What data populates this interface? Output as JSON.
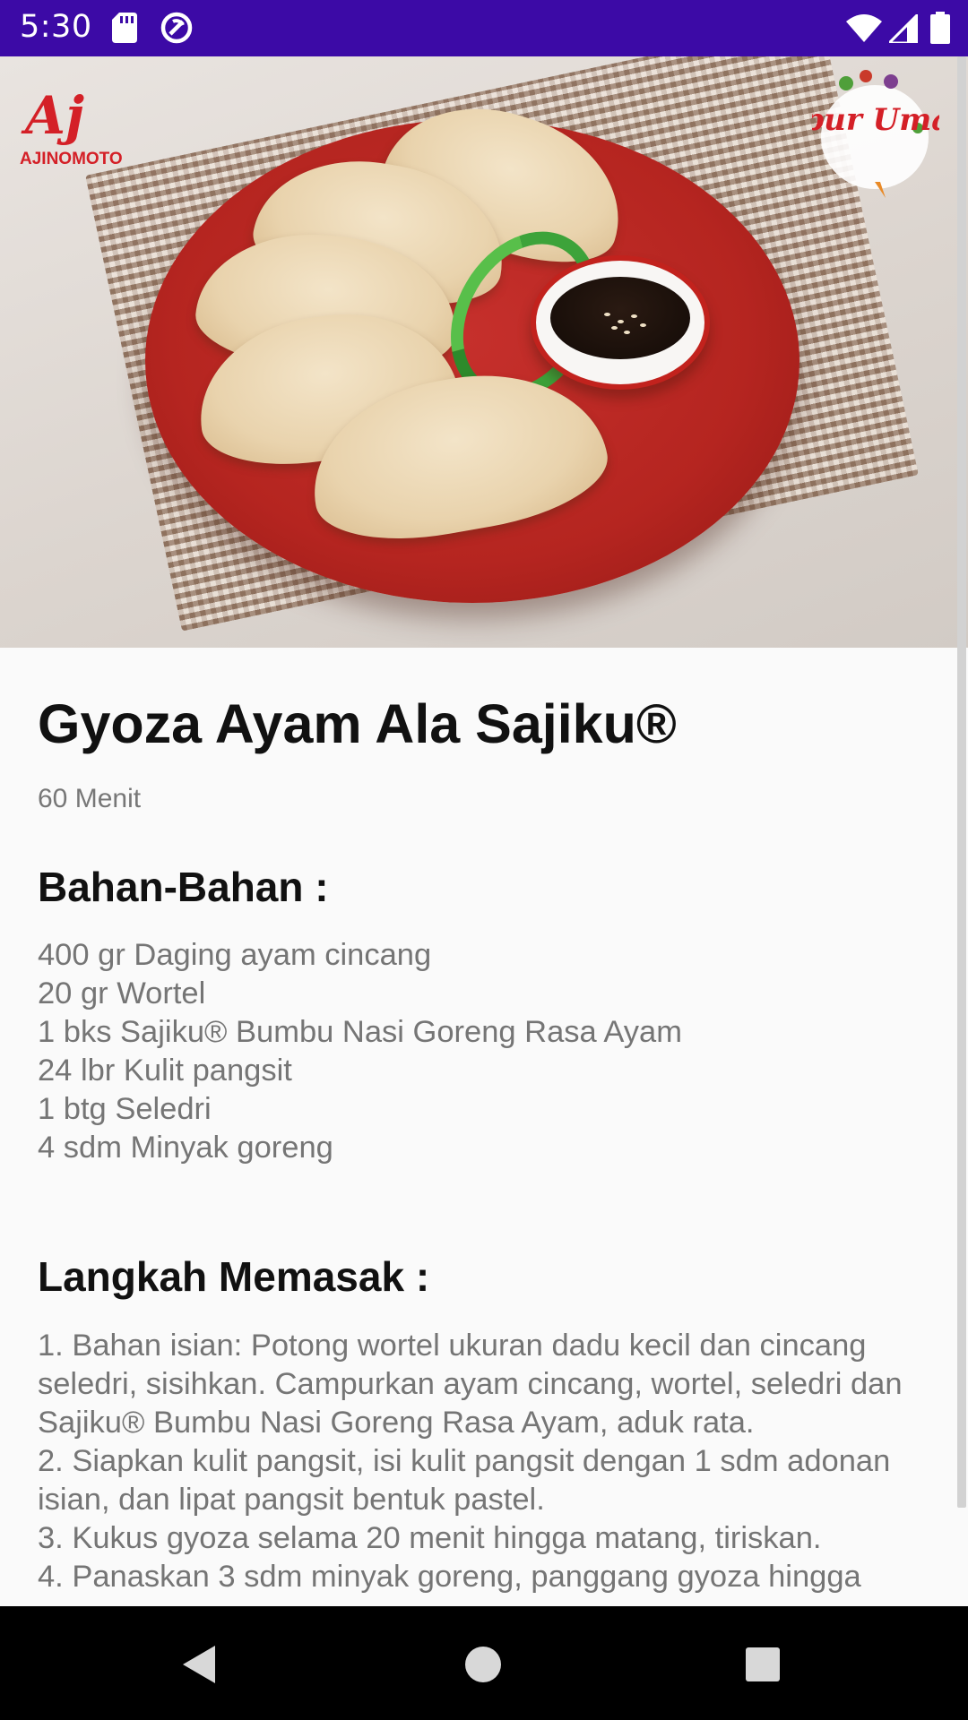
{
  "status_bar": {
    "time": "5:30",
    "icons": [
      "sd-card-icon",
      "sync-icon",
      "wifi-icon",
      "signal-icon",
      "battery-icon"
    ],
    "background": "#3c0aa6"
  },
  "hero": {
    "brand_logo_text": "AJINOMOTO",
    "brand_logo_mark": "Aj",
    "partner_logo_text": "Dapur Umami"
  },
  "recipe": {
    "title": "Gyoza Ayam Ala Sajiku®",
    "duration": "60 Menit",
    "ingredients_heading": "Bahan-Bahan :",
    "ingredients": "400 gr Daging ayam cincang\n20 gr Wortel\n1 bks Sajiku® Bumbu Nasi Goreng Rasa Ayam\n24 lbr Kulit pangsit\n1 btg Seledri\n4 sdm Minyak goreng",
    "steps_heading": "Langkah Memasak :",
    "steps": "1. Bahan isian: Potong wortel ukuran dadu kecil dan cincang seledri, sisihkan. Campurkan ayam cincang, wortel, seledri dan Sajiku® Bumbu Nasi Goreng Rasa Ayam, aduk rata.\n2. Siapkan kulit pangsit, isi kulit pangsit dengan 1 sdm adonan isian, dan lipat pangsit bentuk pastel.\n3. Kukus gyoza selama 20 menit hingga matang, tiriskan.\n4. Panaskan 3 sdm minyak goreng, panggang gyoza hingga"
  },
  "nav_bar": {
    "buttons": [
      "back",
      "home",
      "recents"
    ]
  }
}
